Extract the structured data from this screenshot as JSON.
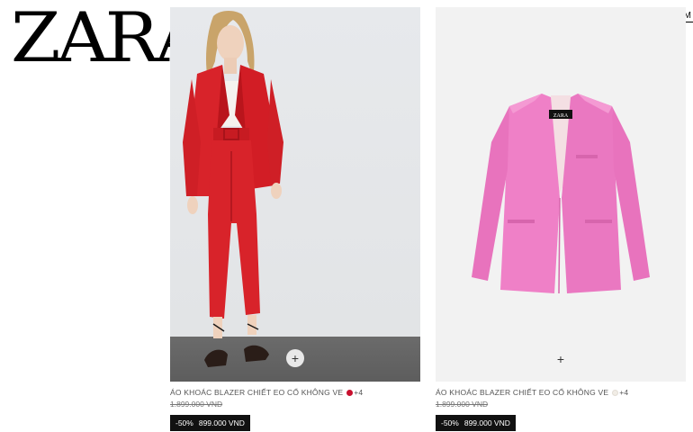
{
  "header": {
    "logo": "ZARA",
    "search_label": "TÌM KIẾM"
  },
  "products": [
    {
      "name": "ÁO KHOÁC BLAZER CHIẾT EO CỔ KHÔNG VE",
      "swatch_color": "#c8102e",
      "more_colors": "+4",
      "old_price": "1.899.000 VND",
      "discount": "-50%",
      "new_price": "899.000 VND",
      "quick_add_icon": "+"
    },
    {
      "name": "ÁO KHOÁC BLAZER CHIẾT EO CỔ KHÔNG VE",
      "swatch_color": "#f1ede6",
      "more_colors": "+4",
      "old_price": "1.899.000 VND",
      "discount": "-50%",
      "new_price": "899.000 VND",
      "quick_add_icon": "+"
    }
  ],
  "colors": {
    "suit_red": "#d8232a",
    "blazer_pink": "#ee7ec6",
    "price_box_bg": "#111111"
  }
}
